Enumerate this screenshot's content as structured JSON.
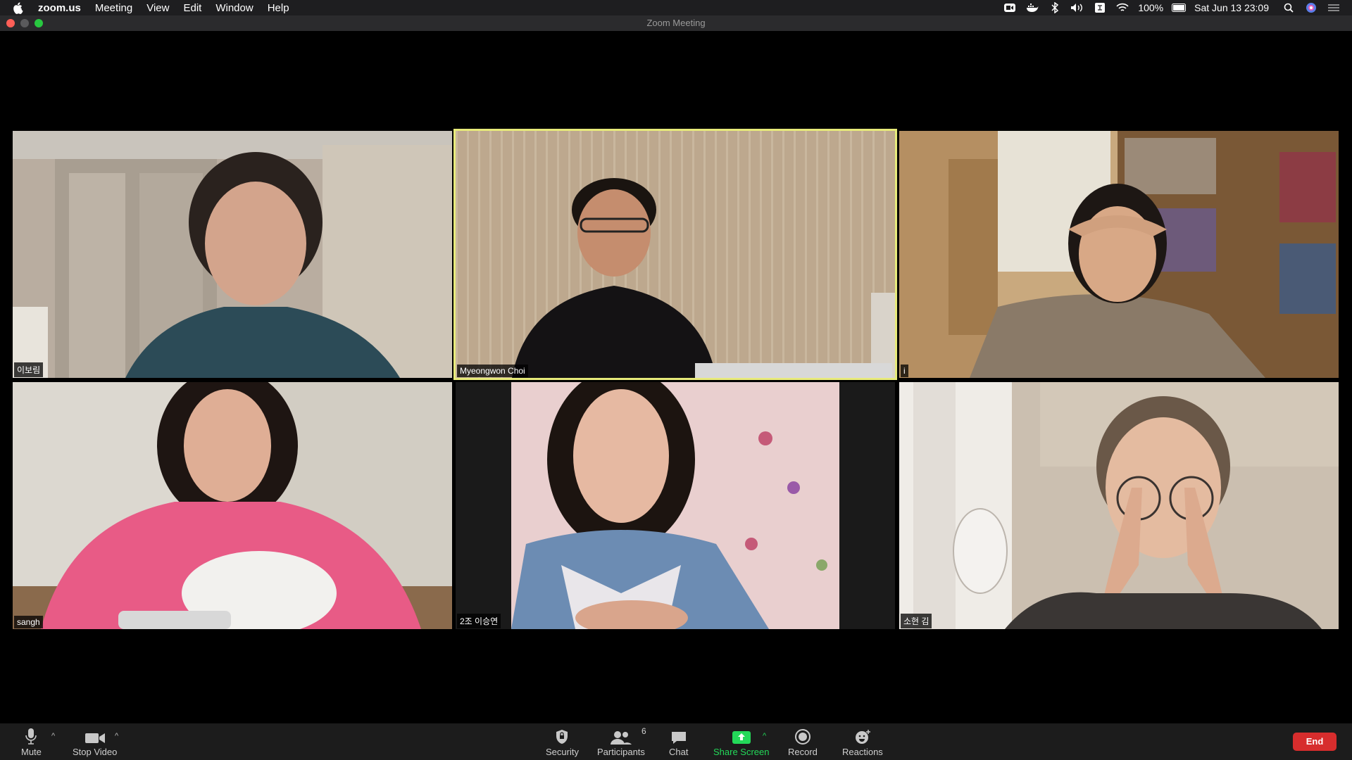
{
  "menubar": {
    "app_name": "zoom.us",
    "menus": [
      "Meeting",
      "View",
      "Edit",
      "Window",
      "Help"
    ],
    "battery": "100%",
    "datetime": "Sat Jun 13  23:09",
    "icons": [
      "zoom-status-icon",
      "docker-icon",
      "bluetooth-icon",
      "volume-icon",
      "input-source-icon",
      "wifi-icon",
      "battery-icon",
      "spotlight-icon",
      "siri-icon",
      "control-center-icon"
    ]
  },
  "window": {
    "title": "Zoom Meeting"
  },
  "participants": [
    {
      "name": "이보림",
      "active": false
    },
    {
      "name": "Myeongwon Choi",
      "active": true
    },
    {
      "name": "i",
      "active": false
    },
    {
      "name": "sangh",
      "active": false
    },
    {
      "name": "2조 이승연",
      "active": false
    },
    {
      "name": "소현 김",
      "active": false
    }
  ],
  "toolbar": {
    "mute_label": "Mute",
    "stop_video_label": "Stop Video",
    "security_label": "Security",
    "participants_label": "Participants",
    "participants_count": "6",
    "chat_label": "Chat",
    "share_screen_label": "Share Screen",
    "record_label": "Record",
    "reactions_label": "Reactions",
    "end_label": "End",
    "share_color": "#23d959",
    "end_color": "#d72d2d"
  },
  "colors": {
    "active_speaker_border": "#e7ea7a"
  }
}
